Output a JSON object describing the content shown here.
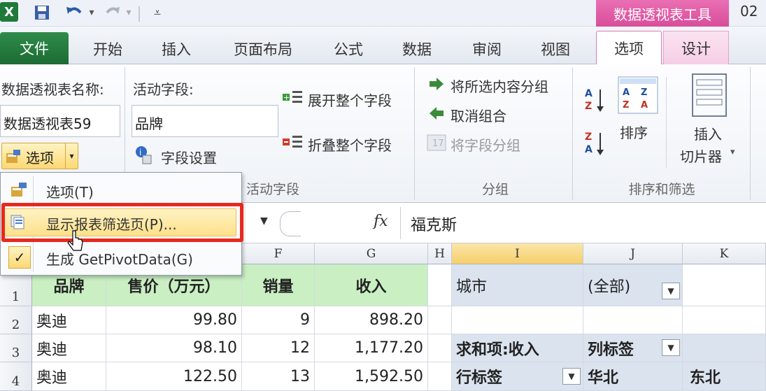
{
  "title_bar": {
    "context_tab_title": "数据透视表工具",
    "trailing_text": "02"
  },
  "tabs": [
    "文件",
    "开始",
    "插入",
    "页面布局",
    "公式",
    "数据",
    "审阅",
    "视图",
    "选项",
    "设计"
  ],
  "ribbon": {
    "pivot_name_label": "数据透视表名称:",
    "pivot_name_value": "数据透视表59",
    "options_button": "选项",
    "active_field_label": "活动字段:",
    "active_field_value": "品牌",
    "field_settings": "字段设置",
    "expand_field": "展开整个字段",
    "collapse_field": "折叠整个字段",
    "active_field_group": "活动字段",
    "group_selection": "将所选内容分组",
    "ungroup": "取消组合",
    "group_field": "将字段分组",
    "group_group": "分组",
    "sort_label": "排序",
    "insert_label": "插入",
    "slicer_label": "切片器",
    "sort_filter_group": "排序和筛选"
  },
  "menu": {
    "items": [
      {
        "label": "选项(T)"
      },
      {
        "label": "显示报表筛选页(P)..."
      },
      {
        "label": "生成 GetPivotData(G)"
      }
    ]
  },
  "formula_bar": {
    "fx": "fx",
    "value": "福克斯"
  },
  "columns": [
    "F",
    "G",
    "H",
    "I",
    "J",
    "K"
  ],
  "rows": [
    "1",
    "2",
    "3",
    "4"
  ],
  "table": {
    "headers": [
      "品牌",
      "售价（万元）",
      "销量",
      "收入"
    ],
    "rows": [
      [
        "奥迪",
        "99.80",
        "9",
        "898.20"
      ],
      [
        "奥迪",
        "98.10",
        "12",
        "1,177.20"
      ],
      [
        "奥迪",
        "122.50",
        "13",
        "1,592.50"
      ]
    ]
  },
  "pivot": {
    "filter_field": "城市",
    "filter_value": "(全部)",
    "sum_label": "求和项:收入",
    "col_labels": "列标签",
    "row_labels": "行标签",
    "col1": "华北",
    "col2": "东北"
  }
}
